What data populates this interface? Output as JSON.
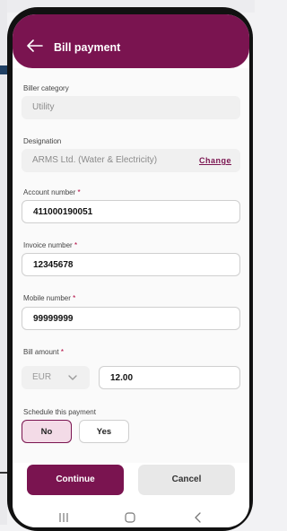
{
  "header": {
    "title": "Bill payment"
  },
  "biller_category": {
    "label": "Biller category",
    "value": "Utility"
  },
  "designation": {
    "label": "Designation",
    "value": "ARMS Ltd. (Water & Electricity)",
    "change_label": "Change"
  },
  "account_number": {
    "label": "Account number",
    "required_mark": "*",
    "value": "411000190051"
  },
  "invoice_number": {
    "label": "Invoice number",
    "required_mark": "*",
    "value": "12345678"
  },
  "mobile_number": {
    "label": "Mobile number",
    "required_mark": "*",
    "value": "99999999"
  },
  "bill_amount": {
    "label": "Bill amount",
    "required_mark": "*",
    "currency": "EUR",
    "value": "12.00"
  },
  "schedule": {
    "label": "Schedule this payment",
    "options": [
      "No",
      "Yes"
    ],
    "selected": "No"
  },
  "actions": {
    "continue_label": "Continue",
    "cancel_label": "Cancel"
  },
  "colors": {
    "brand": "#7a1450",
    "brand_light": "#f3dbe7"
  },
  "icons": {
    "back": "arrow-left-icon",
    "currency_dropdown": "chevron-down-icon",
    "nav": [
      "recent-apps-icon",
      "home-icon",
      "back-nav-icon"
    ]
  }
}
